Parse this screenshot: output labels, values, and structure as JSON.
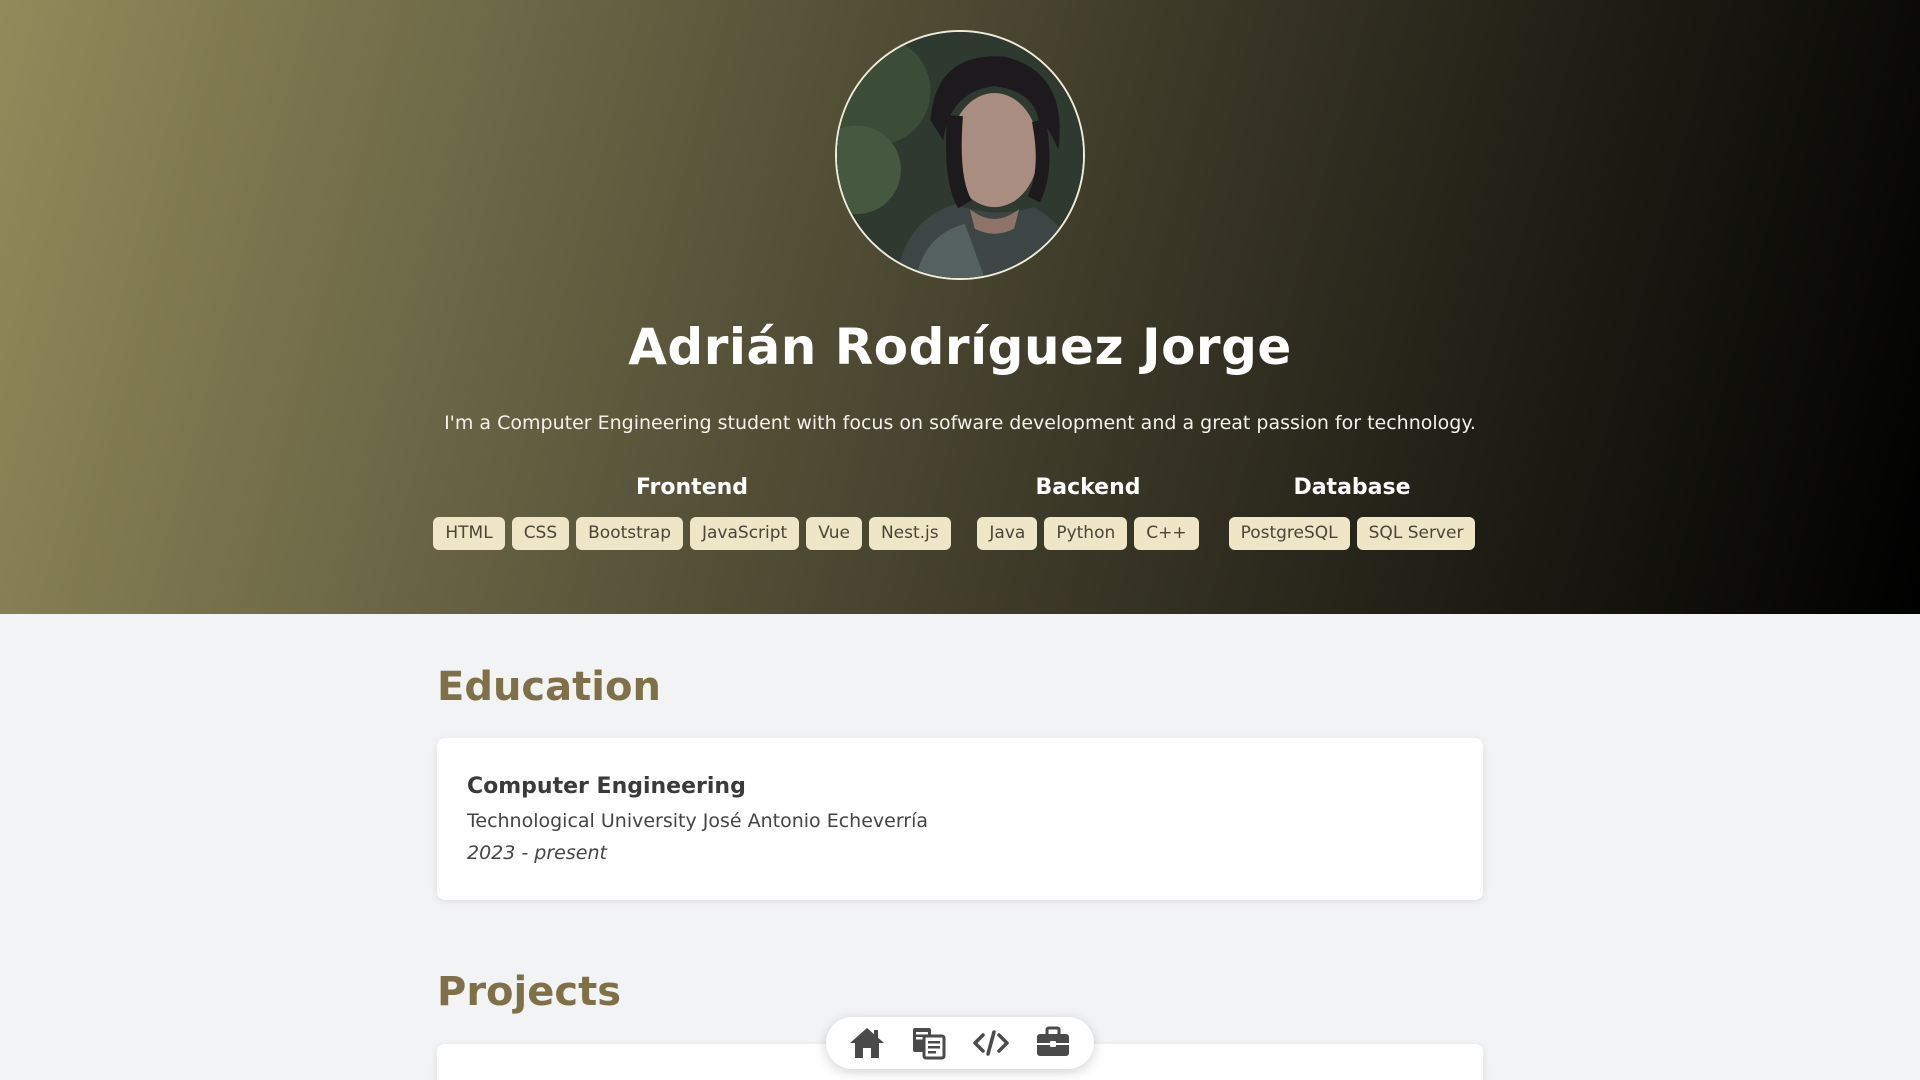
{
  "profile": {
    "name": "Adrián Rodríguez Jorge",
    "bio": "I'm a Computer Engineering student with focus on sofware development and a great passion for technology."
  },
  "skills": {
    "frontend": {
      "title": "Frontend",
      "items": [
        "HTML",
        "CSS",
        "Bootstrap",
        "JavaScript",
        "Vue",
        "Nest.js"
      ]
    },
    "backend": {
      "title": "Backend",
      "items": [
        "Java",
        "Python",
        "C++"
      ]
    },
    "database": {
      "title": "Database",
      "items": [
        "PostgreSQL",
        "SQL Server"
      ]
    }
  },
  "education": {
    "title": "Education",
    "entries": [
      {
        "degree": "Computer Engineering",
        "school": "Technological University José Antonio Echeverría",
        "years": "2023 - present"
      }
    ]
  },
  "projects": {
    "title": "Projects"
  },
  "dock": {
    "items": [
      {
        "icon": "home-icon"
      },
      {
        "icon": "books-icon"
      },
      {
        "icon": "code-icon"
      },
      {
        "icon": "briefcase-icon"
      }
    ]
  },
  "colors": {
    "accent": "#7f7045",
    "tag_bg": "#efe6c7",
    "page_bg": "#f2f3f5"
  }
}
